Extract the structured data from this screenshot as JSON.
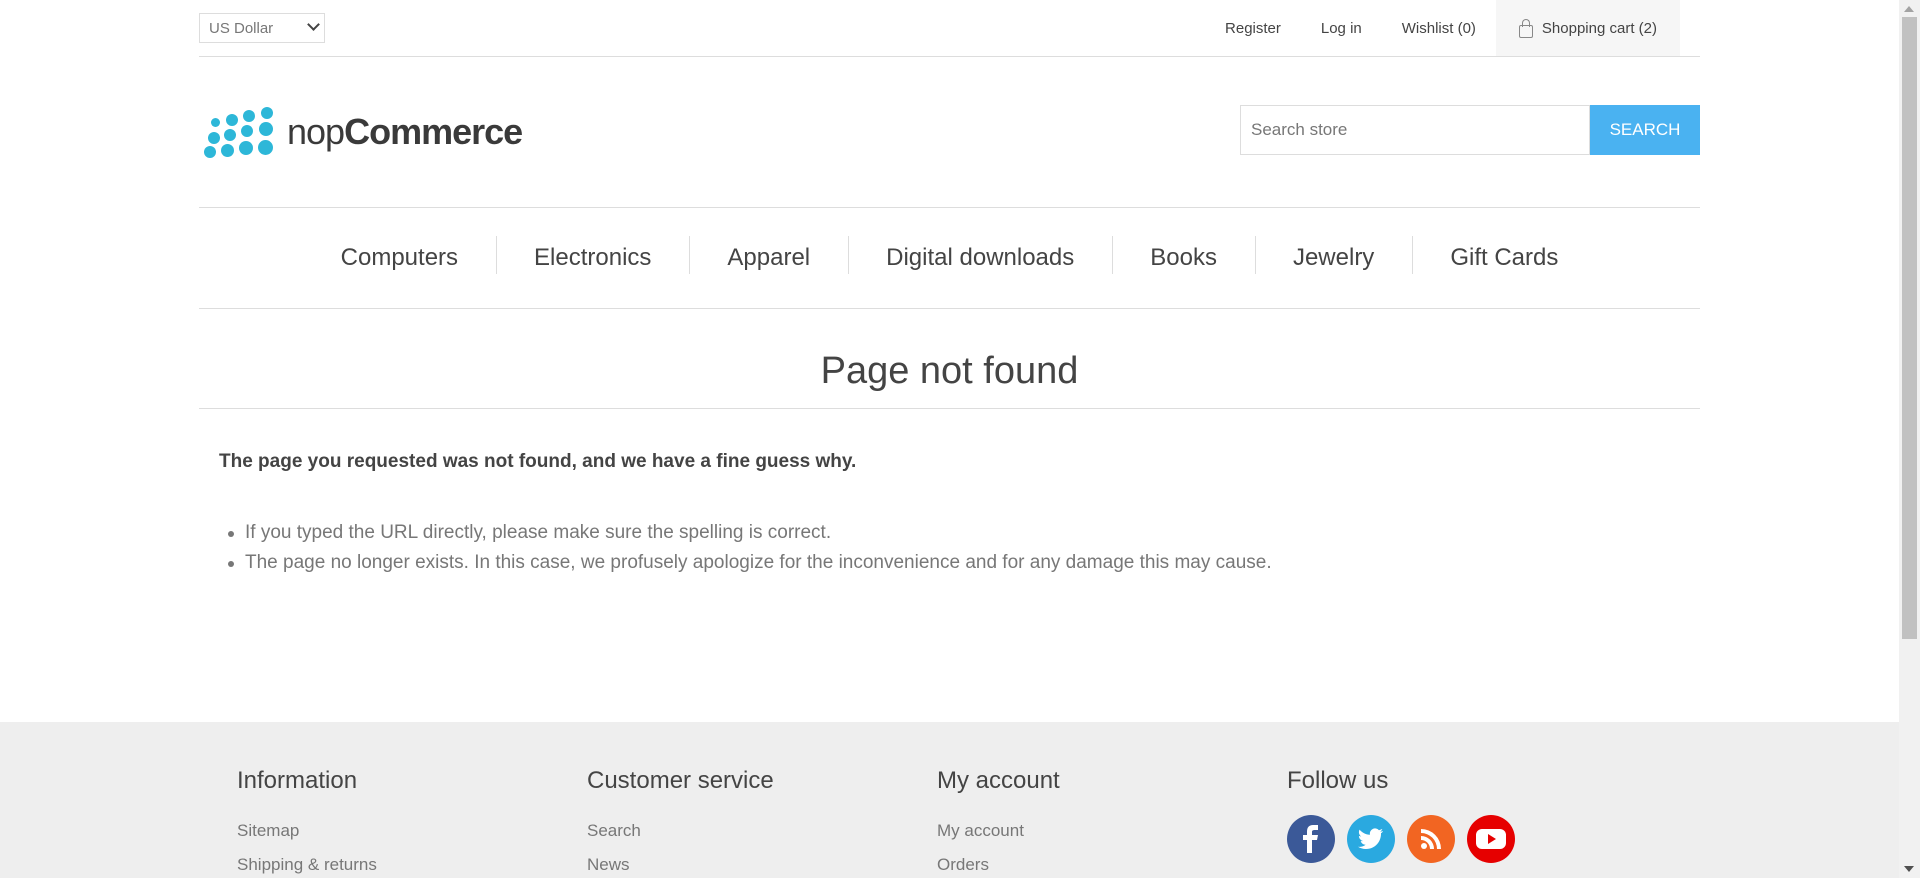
{
  "header": {
    "currency": "US Dollar",
    "links": {
      "register": "Register",
      "login": "Log in",
      "wishlist": "Wishlist (0)",
      "cart": "Shopping cart (2)"
    },
    "logo": {
      "prefix": "nop",
      "suffix": "Commerce"
    },
    "search": {
      "placeholder": "Search store",
      "button": "SEARCH"
    }
  },
  "menu": [
    "Computers",
    "Electronics",
    "Apparel",
    "Digital downloads",
    "Books",
    "Jewelry",
    "Gift Cards"
  ],
  "main": {
    "title": "Page not found",
    "intro": "The page you requested was not found, and we have a fine guess why.",
    "reasons": [
      "If you typed the URL directly, please make sure the spelling is correct.",
      "The page no longer exists. In this case, we profusely apologize for the inconvenience and for any damage this may cause."
    ]
  },
  "footer": {
    "information": {
      "title": "Information",
      "links": [
        "Sitemap",
        "Shipping & returns"
      ]
    },
    "customer_service": {
      "title": "Customer service",
      "links": [
        "Search",
        "News"
      ]
    },
    "my_account": {
      "title": "My account",
      "links": [
        "My account",
        "Orders"
      ]
    },
    "follow_us": {
      "title": "Follow us",
      "icons": [
        "facebook-icon",
        "twitter-icon",
        "rss-icon",
        "youtube-icon"
      ]
    }
  },
  "colors": {
    "accent": "#4ab2f1",
    "logo": "#2db7d8",
    "facebook": "#3b5998",
    "twitter": "#2aa9e0",
    "rss": "#f26522",
    "youtube": "#e60000",
    "footer_bg": "#eeeeee"
  }
}
